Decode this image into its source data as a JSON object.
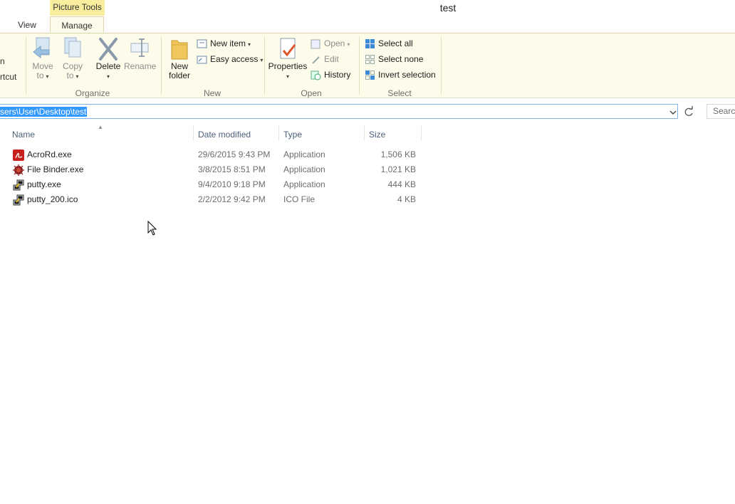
{
  "window": {
    "title": "test",
    "context_tab_group": "Picture Tools"
  },
  "tabs": [
    {
      "label": "View"
    },
    {
      "label": "Manage",
      "selected": true
    }
  ],
  "ribbon": {
    "clipped_left": {
      "label1": "n",
      "label2": "rtcut"
    },
    "organize": {
      "label": "Organize",
      "move_to": {
        "line1": "Move",
        "line2": "to"
      },
      "copy_to": {
        "line1": "Copy",
        "line2": "to"
      },
      "delete": "Delete",
      "rename": "Rename"
    },
    "new": {
      "label": "New",
      "new_folder": {
        "line1": "New",
        "line2": "folder"
      },
      "new_item": "New item",
      "easy_access": "Easy access"
    },
    "open": {
      "label": "Open",
      "properties": "Properties",
      "open": "Open",
      "edit": "Edit",
      "history": "History"
    },
    "select": {
      "label": "Select",
      "select_all": "Select all",
      "select_none": "Select none",
      "invert_selection": "Invert selection"
    }
  },
  "address": {
    "path": "sers\\User\\Desktop\\test"
  },
  "search": {
    "placeholder": "Search"
  },
  "columns": {
    "name": "Name",
    "date_modified": "Date modified",
    "type": "Type",
    "size": "Size"
  },
  "files": [
    {
      "name": "AcroRd.exe",
      "date": "29/6/2015 9:43 PM",
      "type": "Application",
      "size": "1,506 KB",
      "icon": "acrobat-icon"
    },
    {
      "name": "File Binder.exe",
      "date": "3/8/2015 8:51 PM",
      "type": "Application",
      "size": "1,021 KB",
      "icon": "binder-icon"
    },
    {
      "name": "putty.exe",
      "date": "9/4/2010 9:18 PM",
      "type": "Application",
      "size": "444 KB",
      "icon": "putty-icon"
    },
    {
      "name": "putty_200.ico",
      "date": "2/2/2012 9:42 PM",
      "type": "ICO File",
      "size": "4 KB",
      "icon": "putty-icon"
    }
  ],
  "colors": {
    "context_tab": "#f8ee9d",
    "ribbon_bg": "#fdfbe9",
    "selection": "#3399ff",
    "address_border": "#7eb4ea"
  }
}
